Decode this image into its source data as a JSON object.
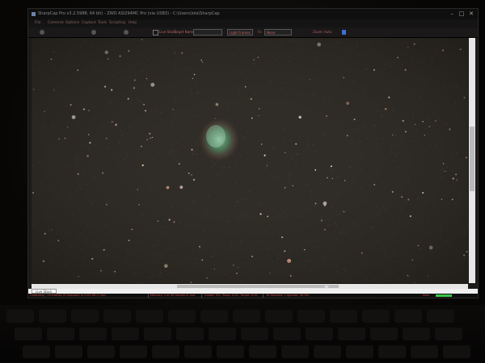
{
  "window": {
    "title": "SharpCap Pro v3.2.5988, 64 bit) - ZWO ASI294MC Pro (via USB3) - C:\\Users\\lola\\SharpCap",
    "min_glyph": "–",
    "max_glyph": "□",
    "close_glyph": "✕"
  },
  "menu": [
    "File",
    "Cameras",
    "Options",
    "Capture",
    "Tools",
    "Scripting",
    "Help"
  ],
  "toolbar": {
    "live_stack_label": "Live Stack",
    "target_name_label": "Target Name:",
    "light_frames_value": "Light Frames",
    "fx_label": "Fx",
    "fx_value": "None",
    "zoom_label": "Zoom:",
    "zoom_value": "Auto"
  },
  "tabs": {
    "live_stack": "Live Stack"
  },
  "status": {
    "capturing": "Capturing - 15 frames (0 dropped) in 0:01:06 (1 fps)",
    "memory": "Memory: 1 of 49 frames in use.",
    "cooler": "Cooler: 0%, Temp: 0.0C, Target: 0.0C",
    "stacked": "16 Stacked, 1 Ignored, 30.0%",
    "right_label": "Dew"
  },
  "colors": {
    "status_meter": "#3cc44a",
    "accent": "#3e6fd0",
    "menu_text": "#8f6060"
  }
}
